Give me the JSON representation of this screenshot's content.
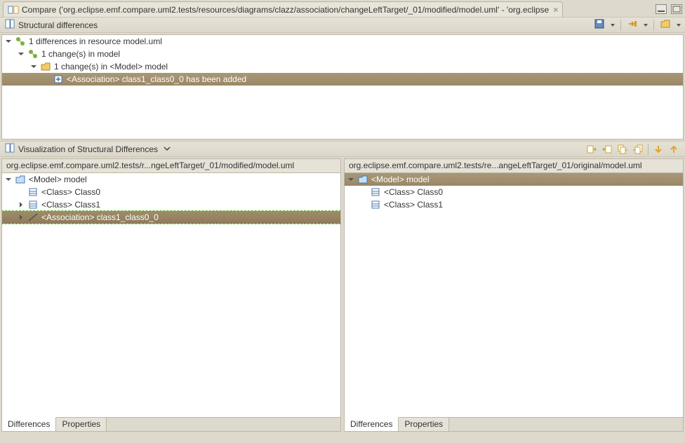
{
  "tab": {
    "title": "Compare ('org.eclipse.emf.compare.uml2.tests/resources/diagrams/clazz/association/changeLeftTarget/_01/modified/model.uml' - 'org.eclipse"
  },
  "structural": {
    "title": "Structural differences",
    "tree": [
      {
        "indent": 0,
        "toggle": "open",
        "icon": "diff-green",
        "label": "1 differences in resource model.uml"
      },
      {
        "indent": 1,
        "toggle": "open",
        "icon": "diff-green",
        "label": "1 change(s) in model"
      },
      {
        "indent": 2,
        "toggle": "open",
        "icon": "package-yellow",
        "label": "1 change(s) in <Model> model"
      },
      {
        "indent": 3,
        "toggle": "none",
        "icon": "add-blue",
        "label": "<Association> class1_class0_0 has been added",
        "selected": true
      }
    ]
  },
  "viz": {
    "title": "Visualization of Structural Differences",
    "left_path": "org.eclipse.emf.compare.uml2.tests/r...ngeLeftTarget/_01/modified/model.uml",
    "right_path": "org.eclipse.emf.compare.uml2.tests/re...angeLeftTarget/_01/original/model.uml",
    "left_tree": [
      {
        "indent": 0,
        "toggle": "open",
        "icon": "folder",
        "label": "<Model> model"
      },
      {
        "indent": 1,
        "toggle": "none",
        "icon": "class",
        "label": "<Class> Class0"
      },
      {
        "indent": 1,
        "toggle": "closed",
        "icon": "class",
        "label": "<Class> Class1"
      },
      {
        "indent": 1,
        "toggle": "closed",
        "icon": "assoc",
        "label": "<Association> class1_class0_0",
        "hl": "green"
      }
    ],
    "right_tree": [
      {
        "indent": 0,
        "toggle": "open",
        "icon": "folder",
        "label": "<Model> model",
        "hl": "brown"
      },
      {
        "indent": 1,
        "toggle": "none",
        "icon": "class",
        "label": "<Class> Class0"
      },
      {
        "indent": 1,
        "toggle": "none",
        "icon": "class",
        "label": "<Class> Class1"
      }
    ],
    "bottom_tabs": [
      "Differences",
      "Properties"
    ]
  }
}
